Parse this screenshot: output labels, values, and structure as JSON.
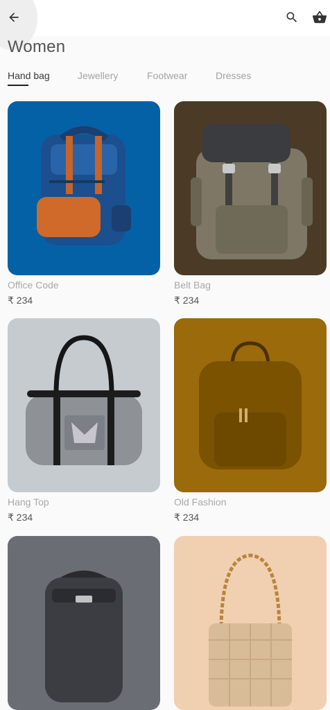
{
  "appbar": {
    "back_icon": "arrow-left-icon",
    "search_icon": "search-icon",
    "cart_icon": "shopping-basket-icon"
  },
  "page": {
    "title": "Women"
  },
  "tabs": [
    {
      "label": "Hand bag",
      "active": true
    },
    {
      "label": "Jewellery",
      "active": false
    },
    {
      "label": "Footwear",
      "active": false
    },
    {
      "label": "Dresses",
      "active": false
    }
  ],
  "products": [
    {
      "name": "Office Code",
      "price": "₹ 234",
      "bg": "#0561a6"
    },
    {
      "name": "Belt Bag",
      "price": "₹ 234",
      "bg": "#4b3b26"
    },
    {
      "name": "Hang Top",
      "price": "₹ 234",
      "bg": "#c5cbcf"
    },
    {
      "name": "Old Fashion",
      "price": "₹ 234",
      "bg": "#9a6a0b"
    },
    {
      "name": "",
      "price": "",
      "bg": "#6b6d74"
    },
    {
      "name": "",
      "price": "",
      "bg": "#f1cfb1"
    }
  ],
  "colors": {
    "background": "#fafafa",
    "appbar": "#ffffff",
    "title": "#535353",
    "tab_active": "#3a3a3a",
    "tab_inactive": "#a3a3a3"
  }
}
